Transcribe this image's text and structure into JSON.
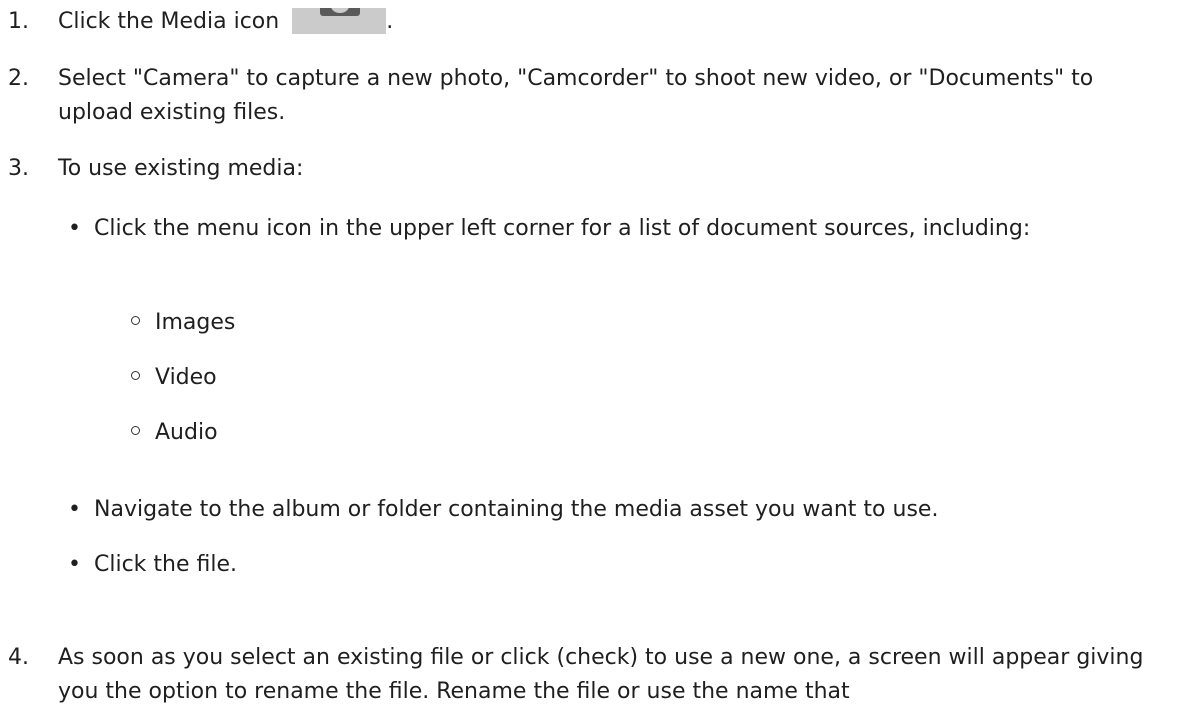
{
  "steps": [
    {
      "number": "1.",
      "text_before_icon": "Click the Media icon",
      "icon": "camera-icon",
      "text_after_icon": "."
    },
    {
      "number": "2.",
      "text": "Select \"Camera\" to capture a new photo, \"Camcorder\" to shoot new video, or \"Documents\" to upload existing files."
    },
    {
      "number": "3.",
      "text": "To use existing media:",
      "bullets": [
        {
          "marker": "•",
          "text": "Click the menu icon in the upper left corner for a list of document sources, including:",
          "sub_items": [
            {
              "text": "Images"
            },
            {
              "text": "Video"
            },
            {
              "text": "Audio"
            }
          ]
        },
        {
          "marker": "•",
          "text": "Navigate to the album or folder containing the media asset you want to use."
        },
        {
          "marker": "•",
          "text": "Click the file."
        }
      ]
    },
    {
      "number": "4.",
      "text": "As soon as you select an existing file or click (check) to use a new one, a screen will appear giving you the option to rename the file. Rename the file or use the name that"
    }
  ],
  "colors": {
    "text": "#1f1f1f",
    "icon_background": "#cbcbcb",
    "icon_glyph": "#5a5a5a"
  }
}
